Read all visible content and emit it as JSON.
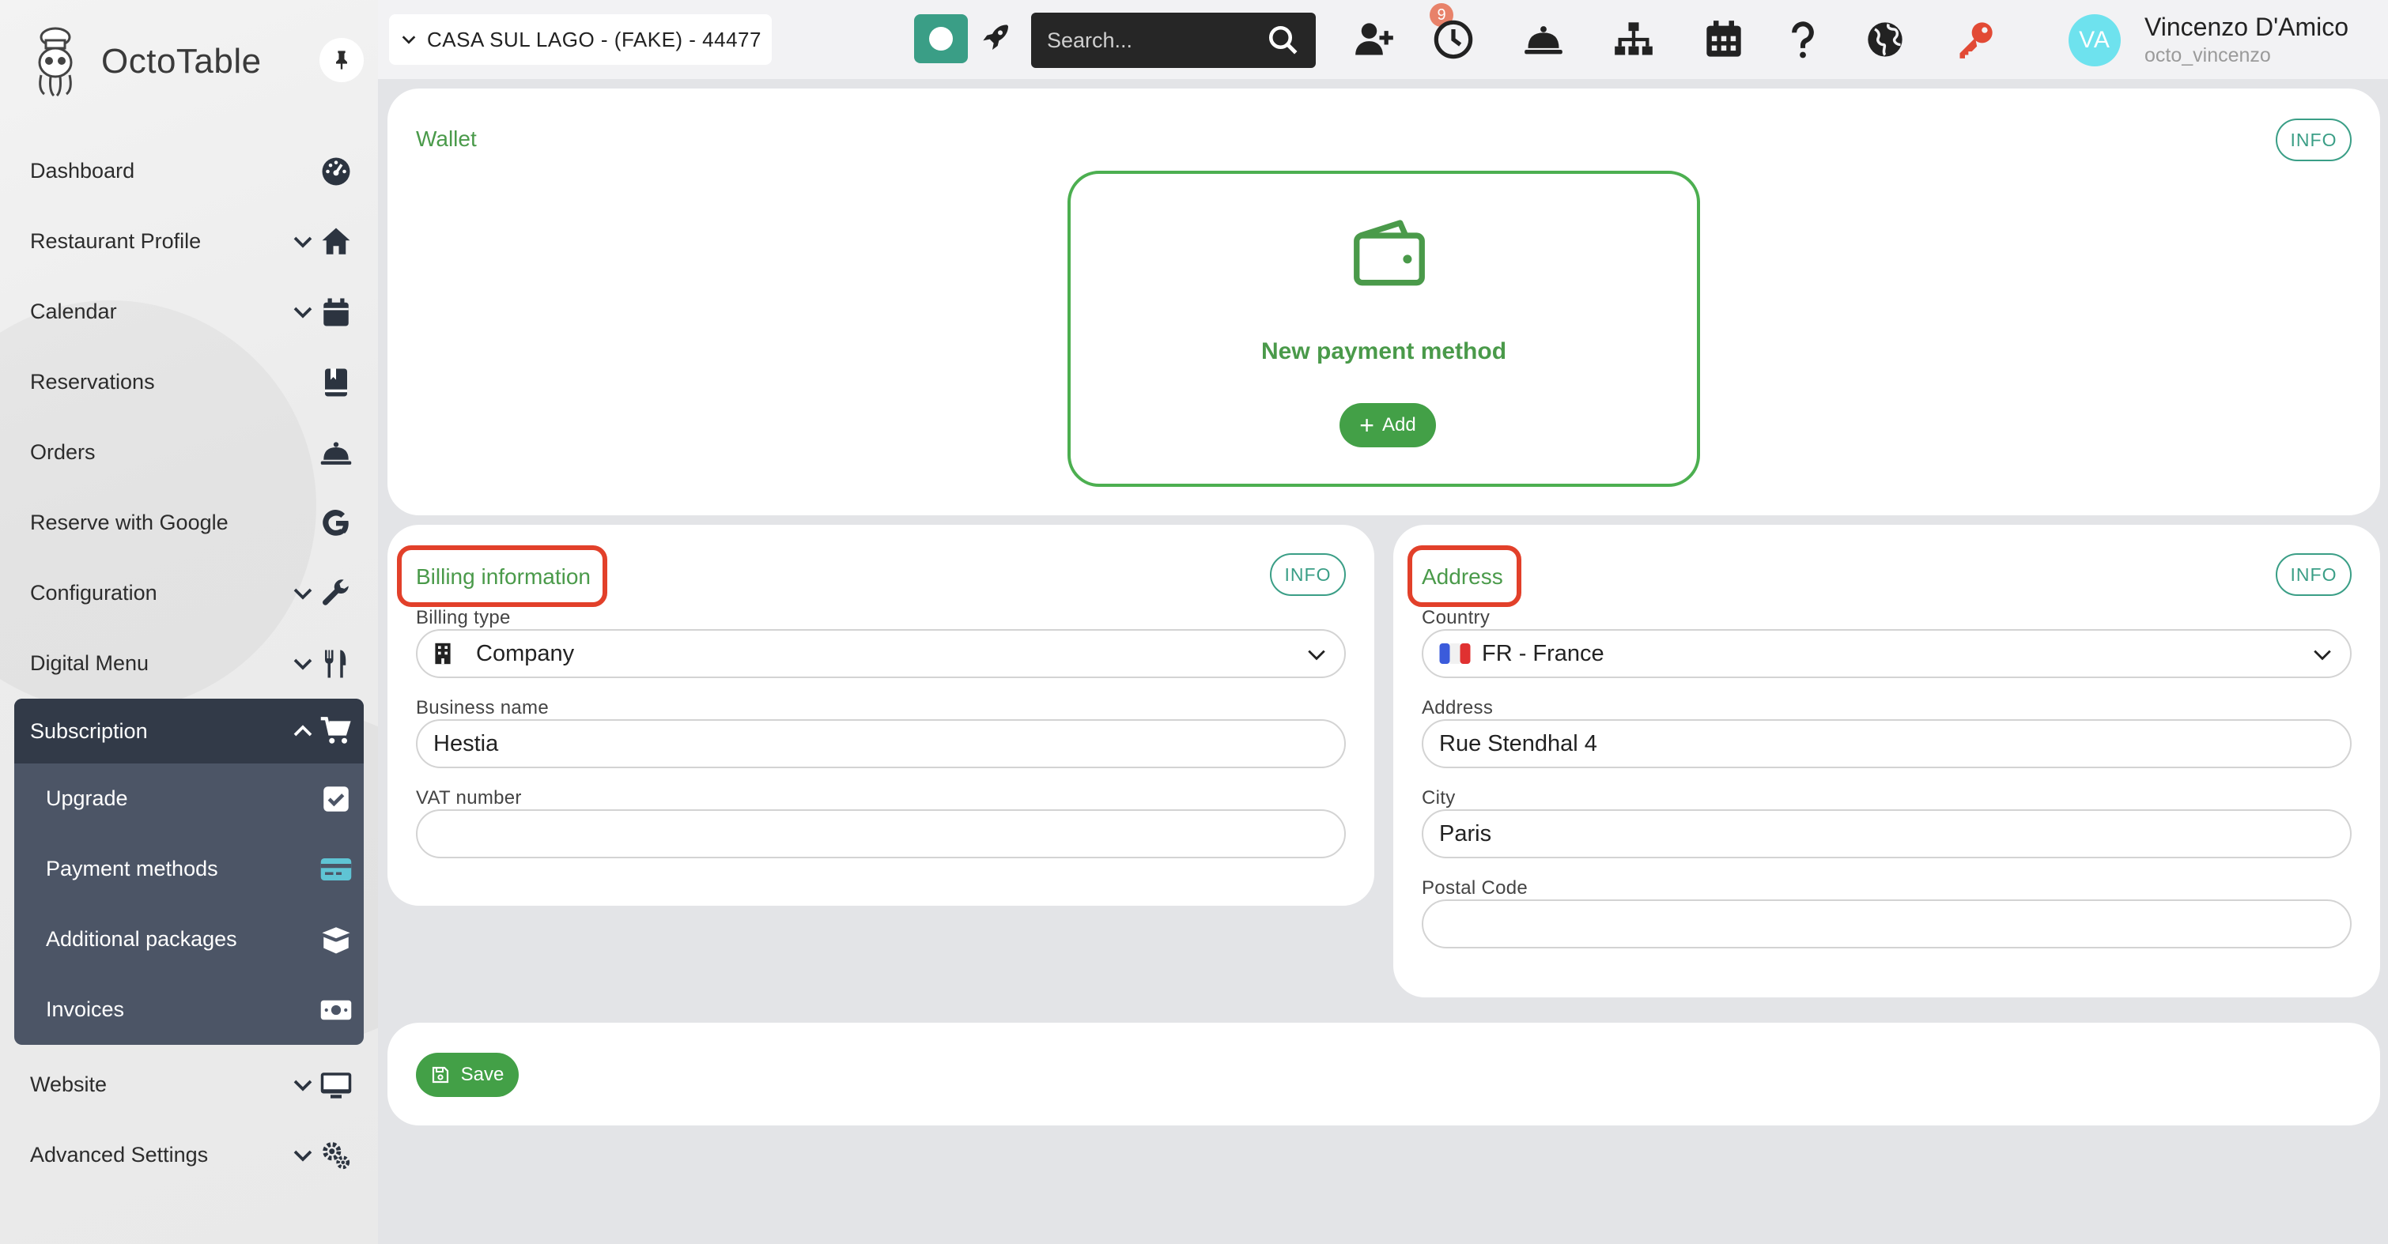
{
  "app": {
    "name": "OctoTable"
  },
  "sidebar": {
    "items": [
      {
        "label": "Dashboard",
        "icon": "dashboard-gauge-icon",
        "expandable": false
      },
      {
        "label": "Restaurant Profile",
        "icon": "home-icon",
        "expandable": true
      },
      {
        "label": "Calendar",
        "icon": "calendar-icon",
        "expandable": true
      },
      {
        "label": "Reservations",
        "icon": "reservations-book-icon",
        "expandable": false
      },
      {
        "label": "Orders",
        "icon": "bell-cloche-icon",
        "expandable": false
      },
      {
        "label": "Reserve with Google",
        "icon": "google-g-icon",
        "expandable": false
      },
      {
        "label": "Configuration",
        "icon": "wrench-icon",
        "expandable": true
      },
      {
        "label": "Digital Menu",
        "icon": "utensils-icon",
        "expandable": true
      }
    ],
    "subscription": {
      "label": "Subscription",
      "icon": "cart-icon",
      "children": [
        {
          "label": "Upgrade",
          "icon": "checkbox-icon"
        },
        {
          "label": "Payment methods",
          "icon": "credit-card-icon",
          "active": true
        },
        {
          "label": "Additional packages",
          "icon": "box-icon"
        },
        {
          "label": "Invoices",
          "icon": "money-bill-icon"
        }
      ]
    },
    "bottom_items": [
      {
        "label": "Website",
        "icon": "monitor-icon",
        "expandable": true
      },
      {
        "label": "Advanced Settings",
        "icon": "gears-icon",
        "expandable": true
      }
    ]
  },
  "topbar": {
    "venue": "CASA SUL LAGO - (FAKE) - 44477",
    "search_placeholder": "Search...",
    "badge_count": "9",
    "user": {
      "initials": "VA",
      "name": "Vincenzo D'Amico",
      "handle": "octo_vincenzo"
    }
  },
  "wallet": {
    "title": "Wallet",
    "info": "INFO",
    "new_payment_method": "New payment method",
    "add_label": "Add"
  },
  "billing": {
    "title": "Billing information",
    "info": "INFO",
    "billing_type_label": "Billing type",
    "billing_type_value": "Company",
    "business_name_label": "Business name",
    "business_name_value": "Hestia",
    "vat_label": "VAT number",
    "vat_value": ""
  },
  "address": {
    "title": "Address",
    "info": "INFO",
    "country_label": "Country",
    "country_value": "FR - France",
    "address_label": "Address",
    "address_value": "Rue Stendhal 4",
    "city_label": "City",
    "city_value": "Paris",
    "postal_label": "Postal Code",
    "postal_value": ""
  },
  "footer": {
    "save_label": "Save"
  },
  "colors": {
    "accent_green": "#43a047",
    "title_green": "#4a9a4a",
    "teal": "#3a9e86",
    "highlight_red": "#e2402a",
    "sidebar_active": "#323a48",
    "sidebar_sub": "#4c5566",
    "card_blue": "#5fc4d4"
  }
}
